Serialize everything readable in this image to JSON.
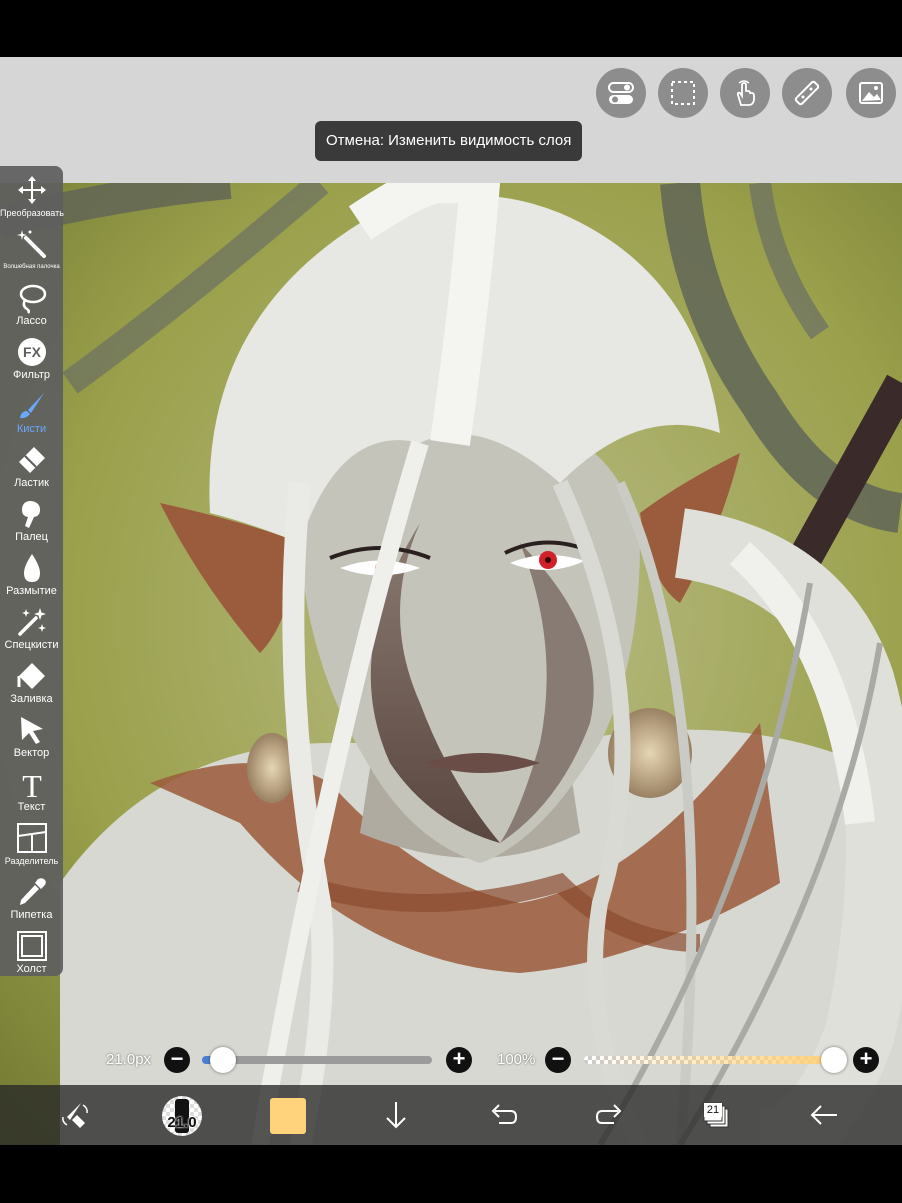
{
  "colors": {
    "accent": "#4c7fd1",
    "current_color": "#ffd27c",
    "toolbox_bg": "#5f5f5f",
    "topbar_bg": "#d6d6d6"
  },
  "top_buttons": [
    {
      "name": "toggle-settings-icon"
    },
    {
      "name": "selection-icon"
    },
    {
      "name": "hand-gesture-icon"
    },
    {
      "name": "ruler-icon"
    },
    {
      "name": "image-material-icon"
    }
  ],
  "toast": {
    "text": "Отмена: Изменить видимость слоя"
  },
  "tools": [
    {
      "icon": "move-arrows-icon",
      "label": "Преобразовать",
      "size": "small"
    },
    {
      "icon": "magic-wand-icon",
      "label": "Волшебная палочка",
      "size": "tiny"
    },
    {
      "icon": "lasso-icon",
      "label": "Лассо"
    },
    {
      "icon": "fx-filter-icon",
      "label": "Фильтр"
    },
    {
      "icon": "brush-icon",
      "label": "Кисти",
      "active": true
    },
    {
      "icon": "eraser-icon",
      "label": "Ластик"
    },
    {
      "icon": "finger-smudge-icon",
      "label": "Палец"
    },
    {
      "icon": "blur-drop-icon",
      "label": "Размытие"
    },
    {
      "icon": "sparkle-effects-icon",
      "label": "Спецкисти"
    },
    {
      "icon": "fill-bucket-icon",
      "label": "Заливка"
    },
    {
      "icon": "vector-cursor-icon",
      "label": "Вектор"
    },
    {
      "icon": "text-icon",
      "label": "Текст"
    },
    {
      "icon": "frame-divider-icon",
      "label": "Разделитель",
      "size": "small"
    },
    {
      "icon": "eyedropper-icon",
      "label": "Пипетка"
    },
    {
      "icon": "canvas-icon",
      "label": "Холст"
    }
  ],
  "brush_size": {
    "value_label": "21.0px",
    "minus": "−",
    "plus": "+",
    "level": 0.09
  },
  "opacity": {
    "value_label": "100%",
    "minus": "−",
    "plus": "+",
    "level": 1.0
  },
  "bottom_bar": {
    "brush_size_indicator": "21.0",
    "layers_count": "21"
  },
  "fx_label": "FX",
  "text_tool_glyph": "T"
}
